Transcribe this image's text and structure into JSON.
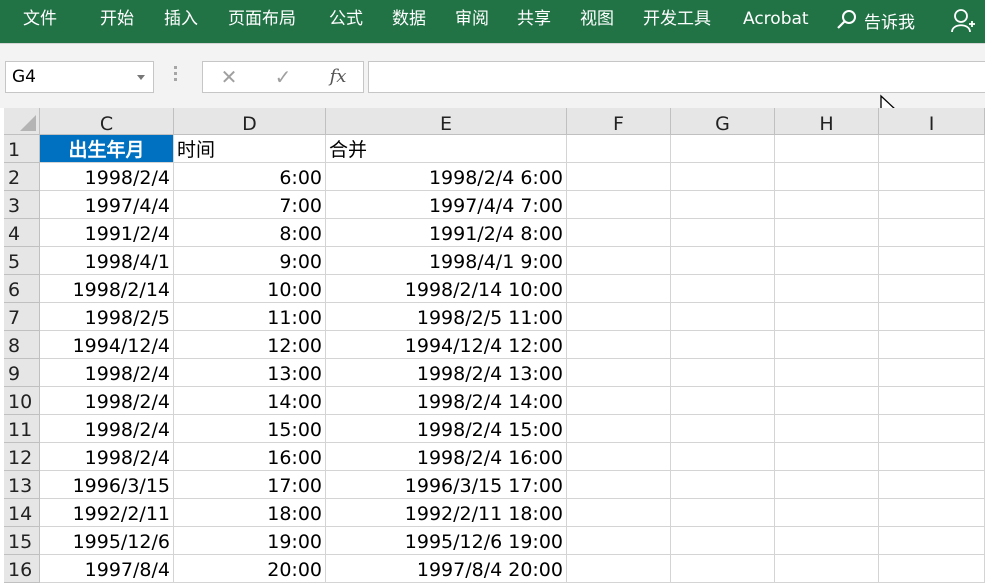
{
  "ribbon": {
    "tabs": [
      "文件",
      "开始",
      "插入",
      "页面布局",
      "公式",
      "数据",
      "审阅",
      "共享",
      "视图",
      "开发工具",
      "Acrobat"
    ],
    "tell_me": "告诉我",
    "background_color": "#217346"
  },
  "formula_bar": {
    "name_box": "G4",
    "cancel_symbol": "✕",
    "enter_symbol": "✓",
    "fx_label": "fx",
    "formula_value": ""
  },
  "sheet": {
    "columns": [
      "C",
      "D",
      "E",
      "F",
      "G",
      "H",
      "I"
    ],
    "rows": [
      {
        "n": "1",
        "c": "出生年月",
        "d": "时间",
        "e": "合并"
      },
      {
        "n": "2",
        "c": "1998/2/4",
        "d": "6:00",
        "e": "1998/2/4 6:00"
      },
      {
        "n": "3",
        "c": "1997/4/4",
        "d": "7:00",
        "e": "1997/4/4 7:00"
      },
      {
        "n": "4",
        "c": "1991/2/4",
        "d": "8:00",
        "e": "1991/2/4 8:00"
      },
      {
        "n": "5",
        "c": "1998/4/1",
        "d": "9:00",
        "e": "1998/4/1 9:00"
      },
      {
        "n": "6",
        "c": "1998/2/14",
        "d": "10:00",
        "e": "1998/2/14 10:00"
      },
      {
        "n": "7",
        "c": "1998/2/5",
        "d": "11:00",
        "e": "1998/2/5 11:00"
      },
      {
        "n": "8",
        "c": "1994/12/4",
        "d": "12:00",
        "e": "1994/12/4 12:00"
      },
      {
        "n": "9",
        "c": "1998/2/4",
        "d": "13:00",
        "e": "1998/2/4 13:00"
      },
      {
        "n": "10",
        "c": "1998/2/4",
        "d": "14:00",
        "e": "1998/2/4 14:00"
      },
      {
        "n": "11",
        "c": "1998/2/4",
        "d": "15:00",
        "e": "1998/2/4 15:00"
      },
      {
        "n": "12",
        "c": "1998/2/4",
        "d": "16:00",
        "e": "1998/2/4 16:00"
      },
      {
        "n": "13",
        "c": "1996/3/15",
        "d": "17:00",
        "e": "1996/3/15 17:00"
      },
      {
        "n": "14",
        "c": "1992/2/11",
        "d": "18:00",
        "e": "1992/2/11 18:00"
      },
      {
        "n": "15",
        "c": "1995/12/6",
        "d": "19:00",
        "e": "1995/12/6 19:00"
      },
      {
        "n": "16",
        "c": "1997/8/4",
        "d": "20:00",
        "e": "1997/8/4 20:00"
      }
    ],
    "header_fill_color": "#0070c0"
  }
}
